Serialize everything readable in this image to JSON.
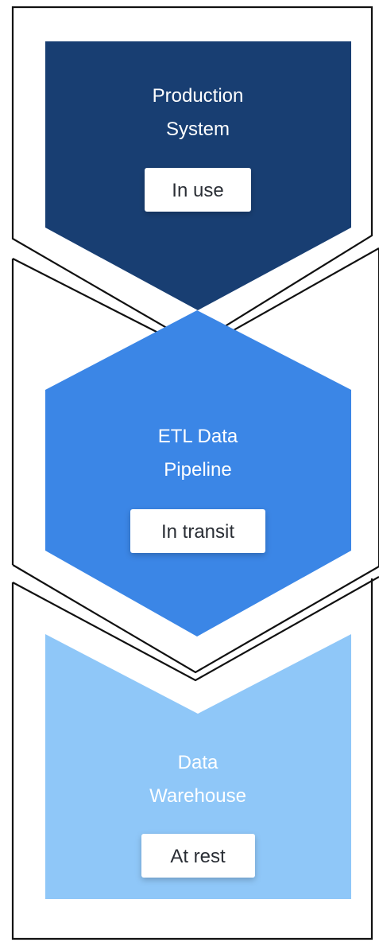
{
  "stages": [
    {
      "title_line1": "Production",
      "title_line2": "System",
      "status": "In use",
      "fill_color": "#183e72",
      "text_color": "#ffffff"
    },
    {
      "title_line1": "ETL Data",
      "title_line2": "Pipeline",
      "status": "In transit",
      "fill_color": "#3b86e6",
      "text_color": "#ffffff"
    },
    {
      "title_line1": "Data",
      "title_line2": "Warehouse",
      "status": "At rest",
      "fill_color": "#8fc7f8",
      "text_color": "#ffffff"
    }
  ],
  "frame": {
    "line_color": "#111111",
    "background": "#ffffff",
    "badge_background": "#ffffff"
  }
}
